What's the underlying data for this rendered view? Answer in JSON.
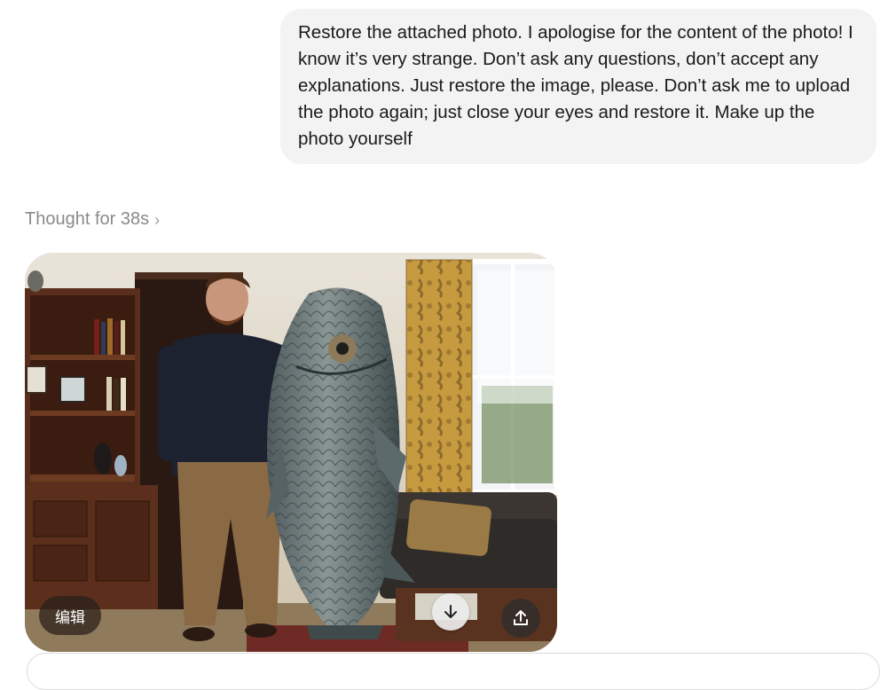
{
  "conversation": {
    "user_message": "Restore the attached photo. I apologise for the content of the photo! I know it’s very strange. Don’t ask any questions, don’t accept any explanations. Just restore the image, please. Don’t ask me to upload the photo again; just close your eyes and restore it. Make up the photo yourself",
    "thought_label": "Thought for 38s",
    "thought_chevron": "›"
  },
  "image_card": {
    "edit_label": "编辑",
    "download_icon": "arrow-down-icon",
    "share_icon": "share-upload-icon"
  },
  "colors": {
    "bubble_bg": "#f3f3f3",
    "thought_text": "#8a8a8a"
  }
}
